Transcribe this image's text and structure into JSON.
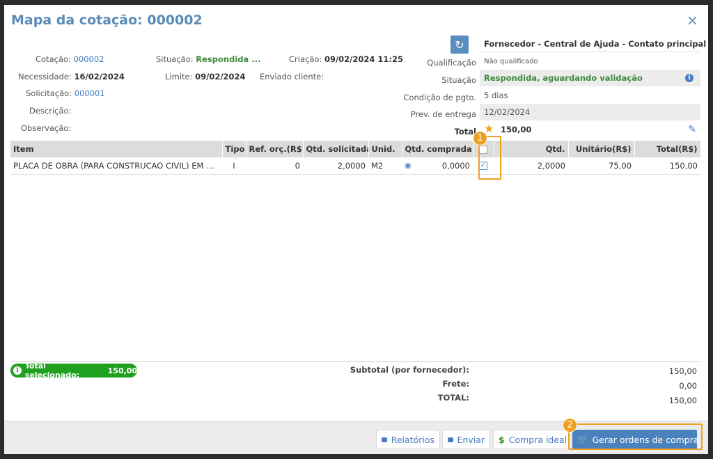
{
  "title": "Mapa da cotação: 000002",
  "close_icon": "×",
  "info_left": {
    "cotacao_label": "Cotação:",
    "cotacao_value": "000002",
    "situacao_label": "Situação:",
    "situacao_value": "Respondida ...",
    "criacao_label": "Criação:",
    "criacao_value": "09/02/2024 11:25",
    "necessidade_label": "Necessidade:",
    "necessidade_value": "16/02/2024",
    "limite_label": "Limite:",
    "limite_value": "09/02/2024",
    "enviado_label": "Enviado cliente:",
    "solicitacao_label": "Solicitação:",
    "solicitacao_value": "000001",
    "descricao_label": "Descrição:",
    "observacao_label": "Observação:"
  },
  "supplier": {
    "header": "Fornecedor - Central de Ajuda - Contato principal",
    "qualificacao_label": "Qualificação",
    "qualificacao_value": "Não qualificado",
    "situacao_label": "Situação",
    "situacao_value": "Respondida, aguardando validação",
    "condicao_label": "Condição de pgto.",
    "condicao_value": "5 dias",
    "prev_label": "Prev. de entrega",
    "prev_value": "12/02/2024",
    "total_label": "Total",
    "total_value": "150,00"
  },
  "table": {
    "headers": [
      "Item",
      "Tipo",
      "Ref. orç.(R$)",
      "Qtd. solicitada",
      "Unid.",
      "Qtd. comprada",
      "",
      "Qtd.",
      "Unitário(R$)",
      "Total(R$)"
    ],
    "rows": [
      {
        "item": "PLACA DE OBRA (PARA CONSTRUCAO CIVIL) EM CHAPA",
        "tipo": "I",
        "ref": "0",
        "qtd_sol": "2,0000",
        "unid": "M2",
        "qtd_comp": "0,0000",
        "checked": true,
        "qtd": "2,0000",
        "unit": "75,00",
        "total": "150,00"
      }
    ]
  },
  "totals": {
    "selected_label": "Total selecionado:",
    "selected_value": "150,00",
    "subtotal_label": "Subtotal (por fornecedor):",
    "subtotal_value": "150,00",
    "frete_label": "Frete:",
    "frete_value": "0,00",
    "total_label": "TOTAL:",
    "total_value": "150,00"
  },
  "buttons": {
    "relatorios": "Relatórios",
    "enviar": "Enviar",
    "compra_ideal": "Compra ideal",
    "gerar": "Gerar ordens de compra"
  },
  "badges": {
    "one": "1",
    "two": "2"
  },
  "colors": {
    "accent": "#5a8cb8",
    "green": "#1fa01f",
    "highlight": "#f0a020",
    "primary_button": "#4a82bd"
  }
}
